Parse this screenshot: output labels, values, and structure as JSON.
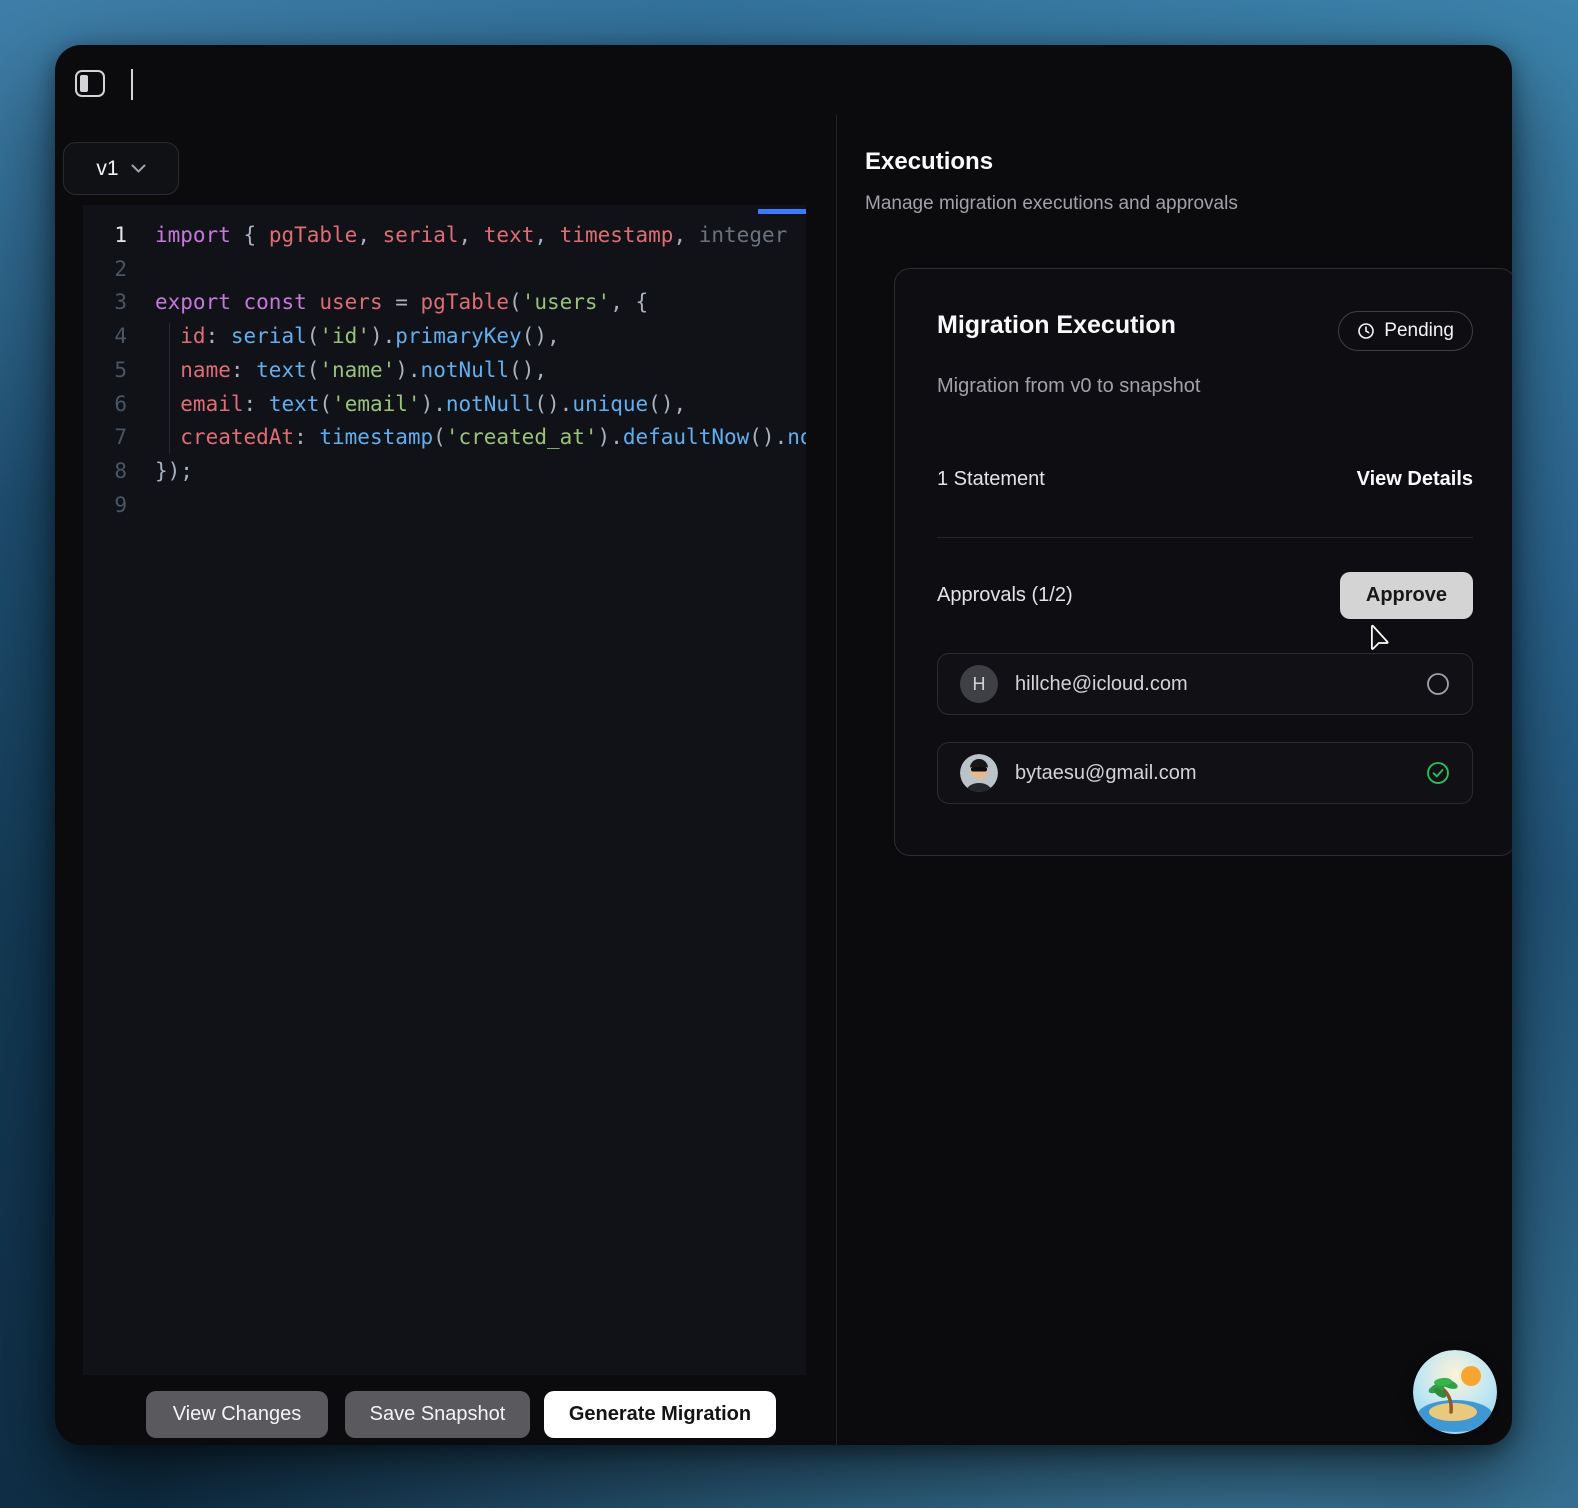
{
  "window": {
    "version": "v1"
  },
  "editor": {
    "active_line": 1,
    "lines": [
      {
        "num": "1",
        "tokens": [
          {
            "t": "import ",
            "c": "kw"
          },
          {
            "t": "{ ",
            "c": "fg"
          },
          {
            "t": "pgTable",
            "c": "var"
          },
          {
            "t": ", ",
            "c": "fg"
          },
          {
            "t": "serial",
            "c": "var"
          },
          {
            "t": ", ",
            "c": "fg"
          },
          {
            "t": "text",
            "c": "var"
          },
          {
            "t": ", ",
            "c": "fg"
          },
          {
            "t": "timestamp",
            "c": "var"
          },
          {
            "t": ", ",
            "c": "fg"
          },
          {
            "t": "integer",
            "c": "dim"
          }
        ]
      },
      {
        "num": "2",
        "tokens": []
      },
      {
        "num": "3",
        "tokens": [
          {
            "t": "export ",
            "c": "kw"
          },
          {
            "t": "const ",
            "c": "kw"
          },
          {
            "t": "users ",
            "c": "var"
          },
          {
            "t": "= ",
            "c": "fg"
          },
          {
            "t": "pgTable",
            "c": "var"
          },
          {
            "t": "(",
            "c": "fg"
          },
          {
            "t": "'users'",
            "c": "str"
          },
          {
            "t": ", {",
            "c": "fg"
          }
        ]
      },
      {
        "num": "4",
        "tokens": [
          {
            "t": "  id",
            "c": "var"
          },
          {
            "t": ": ",
            "c": "fg"
          },
          {
            "t": "serial",
            "c": "fn"
          },
          {
            "t": "(",
            "c": "fg"
          },
          {
            "t": "'id'",
            "c": "str"
          },
          {
            "t": ").",
            "c": "fg"
          },
          {
            "t": "primaryKey",
            "c": "fn"
          },
          {
            "t": "(),",
            "c": "fg"
          }
        ]
      },
      {
        "num": "5",
        "tokens": [
          {
            "t": "  name",
            "c": "var"
          },
          {
            "t": ": ",
            "c": "fg"
          },
          {
            "t": "text",
            "c": "fn"
          },
          {
            "t": "(",
            "c": "fg"
          },
          {
            "t": "'name'",
            "c": "str"
          },
          {
            "t": ").",
            "c": "fg"
          },
          {
            "t": "notNull",
            "c": "fn"
          },
          {
            "t": "(),",
            "c": "fg"
          }
        ]
      },
      {
        "num": "6",
        "tokens": [
          {
            "t": "  email",
            "c": "var"
          },
          {
            "t": ": ",
            "c": "fg"
          },
          {
            "t": "text",
            "c": "fn"
          },
          {
            "t": "(",
            "c": "fg"
          },
          {
            "t": "'email'",
            "c": "str"
          },
          {
            "t": ").",
            "c": "fg"
          },
          {
            "t": "notNull",
            "c": "fn"
          },
          {
            "t": "().",
            "c": "fg"
          },
          {
            "t": "unique",
            "c": "fn"
          },
          {
            "t": "(),",
            "c": "fg"
          }
        ]
      },
      {
        "num": "7",
        "tokens": [
          {
            "t": "  createdAt",
            "c": "var"
          },
          {
            "t": ": ",
            "c": "fg"
          },
          {
            "t": "timestamp",
            "c": "fn"
          },
          {
            "t": "(",
            "c": "fg"
          },
          {
            "t": "'created_at'",
            "c": "str"
          },
          {
            "t": ").",
            "c": "fg"
          },
          {
            "t": "defaultNow",
            "c": "fn"
          },
          {
            "t": "().",
            "c": "fg"
          },
          {
            "t": "notNull",
            "c": "fn"
          },
          {
            "t": "(),",
            "c": "fg"
          }
        ]
      },
      {
        "num": "8",
        "tokens": [
          {
            "t": "});",
            "c": "fg"
          }
        ]
      },
      {
        "num": "9",
        "tokens": []
      }
    ]
  },
  "footer": {
    "view_changes": "View Changes",
    "save_snapshot": "Save Snapshot",
    "generate_migration": "Generate Migration"
  },
  "panel": {
    "title": "Executions",
    "subtitle": "Manage migration executions and approvals",
    "card": {
      "title": "Migration Execution",
      "badge": "Pending",
      "description": "Migration from v0 to snapshot",
      "statements": "1 Statement",
      "view_details": "View Details",
      "approvals_label": "Approvals (1/2)",
      "approve_button": "Approve",
      "approvers": [
        {
          "initial": "H",
          "email": "hillche@icloud.com",
          "approved": false
        },
        {
          "photo": true,
          "email": "bytaesu@gmail.com",
          "approved": true
        }
      ]
    }
  },
  "colors": {
    "accent_blue": "#3d7bfd",
    "approved_green": "#22c55e",
    "window_bg": "#0b0b0e"
  }
}
